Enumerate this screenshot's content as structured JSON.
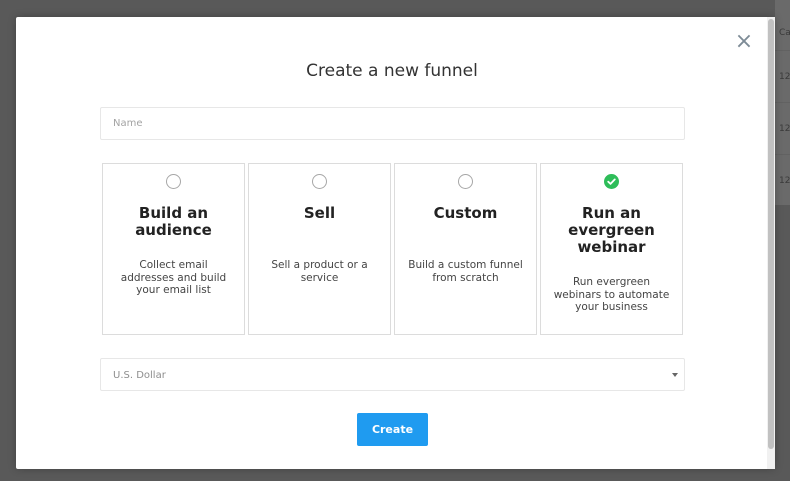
{
  "modal": {
    "title": "Create a new funnel",
    "close_symbol": "×",
    "name_field": {
      "value": "",
      "placeholder": "Name"
    },
    "options": [
      {
        "title": "Build an audience",
        "title_lines": [
          "Build an",
          "audience"
        ],
        "description_lines": [
          "Collect email",
          "addresses and build",
          "your email list"
        ],
        "selected": false
      },
      {
        "title": "Sell",
        "title_lines": [
          "Sell"
        ],
        "description_lines": [
          "Sell a product or a",
          "service"
        ],
        "selected": false
      },
      {
        "title": "Custom",
        "title_lines": [
          "Custom"
        ],
        "description_lines": [
          "Build a custom funnel",
          "from scratch"
        ],
        "selected": false
      },
      {
        "title": "Run an evergreen webinar",
        "title_lines": [
          "Run an",
          "evergreen",
          "webinar"
        ],
        "description_lines": [
          "Run evergreen",
          "webinars to automate",
          "your business"
        ],
        "selected": true
      }
    ],
    "currency": {
      "selected": "U.S. Dollar"
    },
    "create_label": "Create"
  },
  "background": {
    "cells": [
      "Ca",
      "12",
      "12",
      "12"
    ]
  },
  "colors": {
    "accent": "#1f9bf0",
    "selected_check": "#2ebd59",
    "overlay": "#595959"
  },
  "icons": {
    "close": "close-icon",
    "checked": "check-icon",
    "dropdown": "chevron-down-icon"
  }
}
